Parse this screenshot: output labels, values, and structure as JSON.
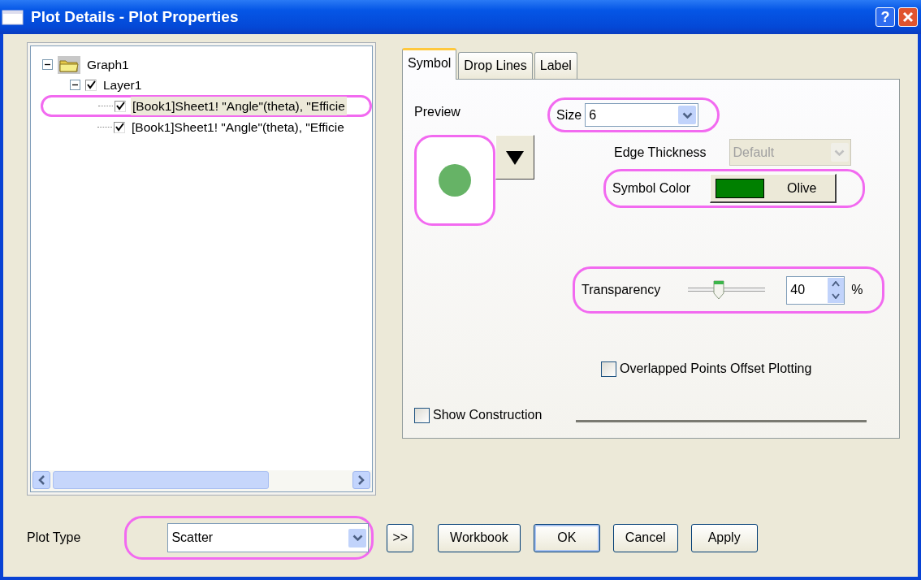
{
  "window": {
    "title": "Plot Details - Plot Properties",
    "help": "?"
  },
  "tree": [
    {
      "label": "Graph1",
      "kind": "folder",
      "expanded": true,
      "children": [
        {
          "label": "Layer1",
          "expanded": true,
          "checked": true,
          "children": [
            {
              "label": "[Book1]Sheet1! \"Angle\"(theta), \"Efficie",
              "checked": true,
              "selected": true,
              "highlighted": true
            },
            {
              "label": "[Book1]Sheet1! \"Angle\"(theta), \"Efficie",
              "checked": true,
              "selected": false,
              "highlighted": false
            }
          ]
        }
      ]
    }
  ],
  "tabs": [
    {
      "label": "Symbol",
      "selected": true
    },
    {
      "label": "Drop Lines",
      "selected": false
    },
    {
      "label": "Label",
      "selected": false
    }
  ],
  "preview": {
    "label": "Preview",
    "highlighted": true
  },
  "size": {
    "label": "Size",
    "value": "6",
    "highlighted": true
  },
  "edge_thickness": {
    "label": "Edge Thickness",
    "value": "Default",
    "disabled": true
  },
  "symbol_color": {
    "label": "Symbol Color",
    "value": "Olive",
    "color": "#008000",
    "highlighted": true
  },
  "transparency": {
    "label": "Transparency",
    "level": 0.4,
    "value": "40",
    "unit": "%",
    "highlighted": true
  },
  "overlapped": {
    "label": "Overlapped Points Offset Plotting",
    "checked": false
  },
  "show_construction": {
    "label": "Show Construction",
    "checked": false
  },
  "plot_type": {
    "label": "Plot Type",
    "value": "Scatter",
    "highlighted": true
  },
  "buttons": [
    {
      "label": ">>",
      "default": false
    },
    {
      "label": "Workbook",
      "default": false
    },
    {
      "label": "OK",
      "default": true
    },
    {
      "label": "Cancel",
      "default": false
    },
    {
      "label": "Apply",
      "default": false
    }
  ]
}
